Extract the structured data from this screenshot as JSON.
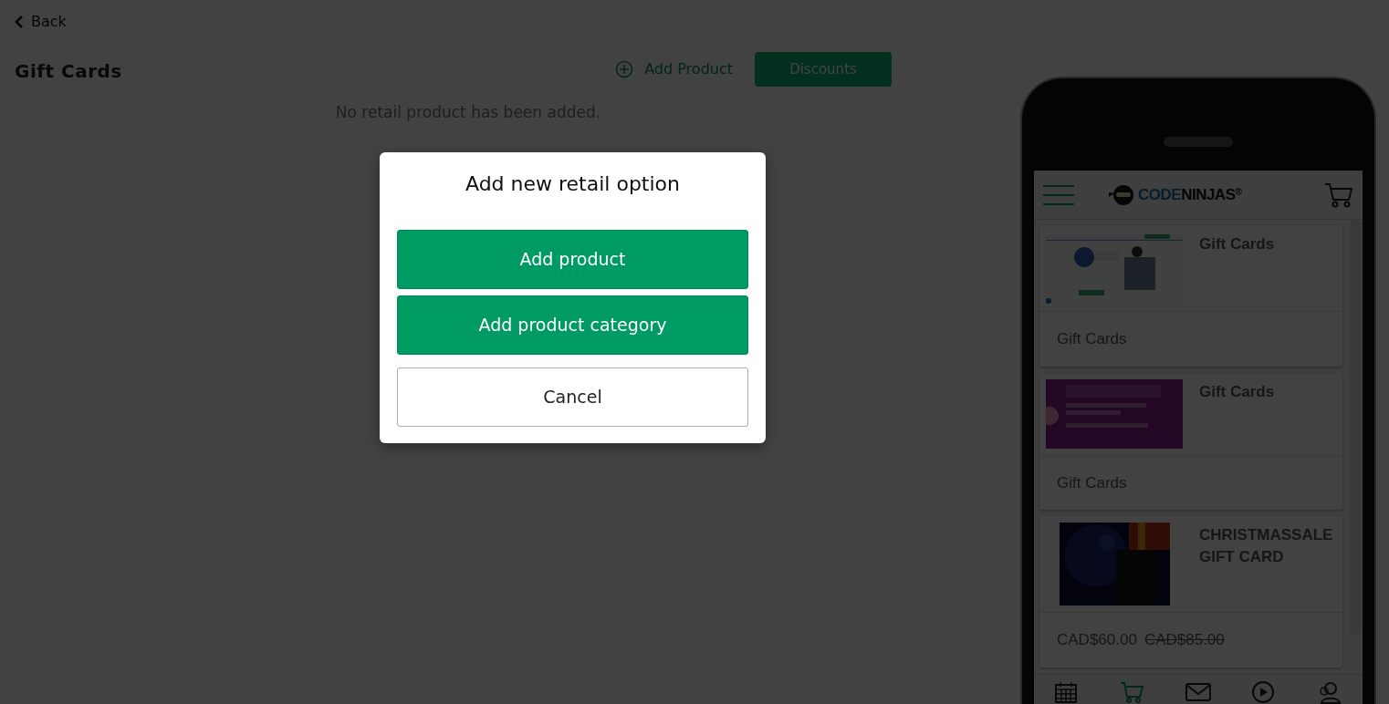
{
  "back": {
    "label": "Back"
  },
  "page_title": "Gift Cards",
  "actions": {
    "add_product": "Add Product",
    "discounts": "Discounts"
  },
  "empty_message": "No retail product has been added.",
  "modal": {
    "title": "Add new retail option",
    "buttons": [
      {
        "label": "Add product",
        "kind": "primary"
      },
      {
        "label": "Add product category",
        "kind": "primary"
      },
      {
        "label": "Cancel",
        "kind": "secondary"
      }
    ]
  },
  "preview": {
    "logo": {
      "first": "CODE",
      "second": "NINJAS$^{®}$"
    },
    "products": [
      {
        "title": "Gift Cards",
        "footer": {
          "kind": "subtitle",
          "text": "Gift Cards"
        }
      },
      {
        "title": "Gift Cards",
        "footer": {
          "kind": "subtitle",
          "text": "Gift Cards"
        }
      },
      {
        "title": "CHRISTMASSALE GIFT CARD",
        "footer": {
          "kind": "price",
          "price": "CAD$60.00",
          "old_price": "CAD$85.00"
        }
      }
    ],
    "nav": [
      {
        "kind": "calendar",
        "selected": false
      },
      {
        "kind": "cart",
        "selected": true
      },
      {
        "kind": "mail",
        "selected": false
      },
      {
        "kind": "play",
        "selected": false
      },
      {
        "kind": "people",
        "selected": false
      }
    ]
  }
}
